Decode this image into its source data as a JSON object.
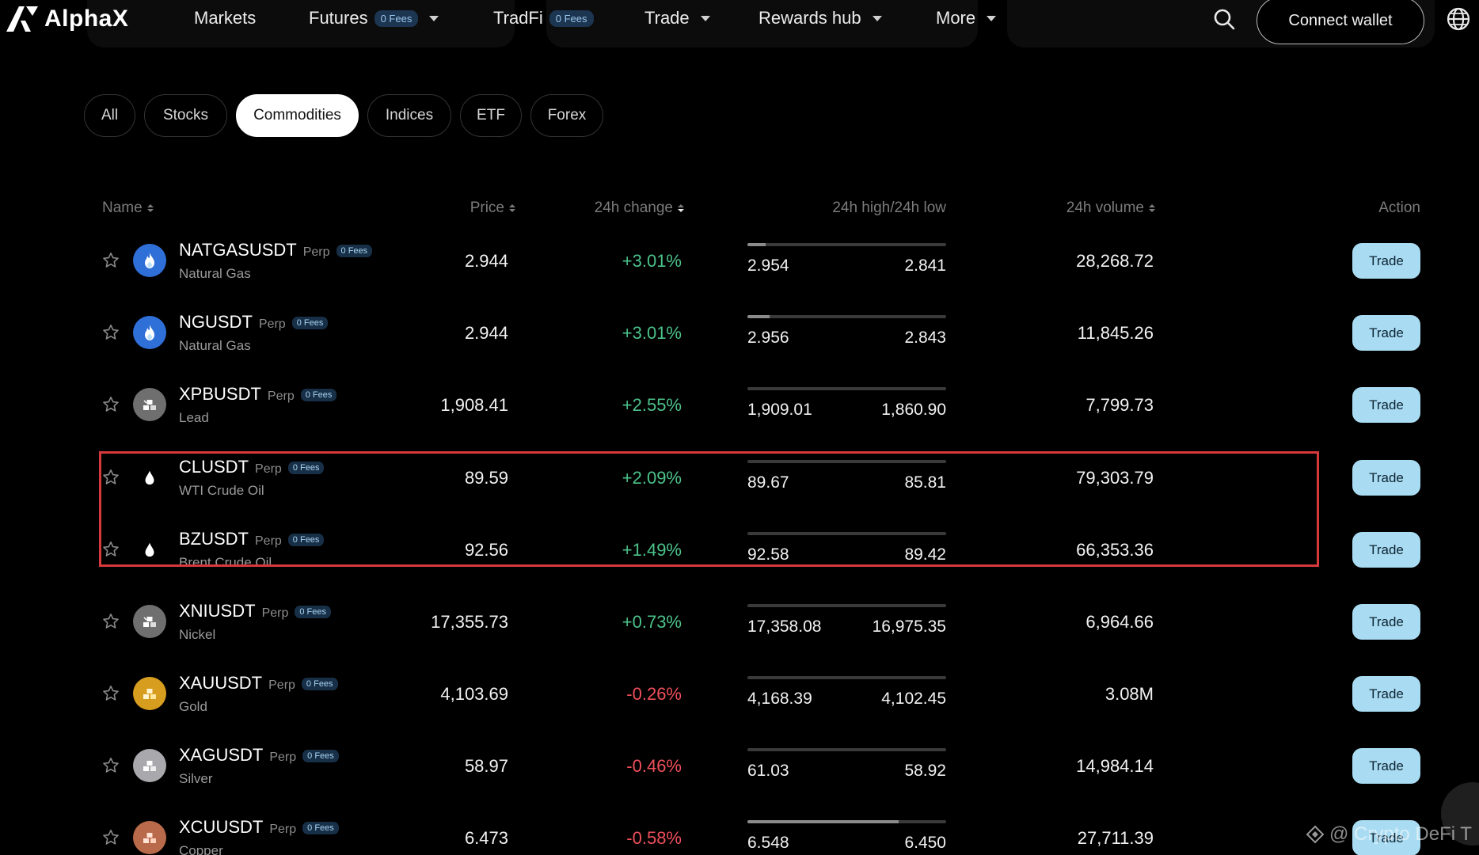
{
  "app": {
    "logo_text": "AlphaX"
  },
  "nav": {
    "items": [
      {
        "label": "Markets",
        "badge": "",
        "caret": false
      },
      {
        "label": "Futures",
        "badge": "0 Fees",
        "caret": true
      },
      {
        "label": "TradFi",
        "badge": "0 Fees",
        "caret": false
      },
      {
        "label": "Trade",
        "badge": "",
        "caret": true
      },
      {
        "label": "Rewards hub",
        "badge": "",
        "caret": true
      },
      {
        "label": "More",
        "badge": "",
        "caret": true
      }
    ],
    "connect_wallet": "Connect wallet"
  },
  "filters": {
    "tabs": [
      "All",
      "Stocks",
      "Commodities",
      "Indices",
      "ETF",
      "Forex"
    ],
    "active": "Commodities"
  },
  "table": {
    "headers": {
      "name": "Name",
      "price": "Price",
      "change": "24h change",
      "high_low": "24h high/24h low",
      "volume": "24h volume",
      "action": "Action"
    },
    "perp_label": "Perp",
    "fees_label": "0 Fees",
    "trade_label": "Trade",
    "rows": [
      {
        "symbol": "NATGASUSDT",
        "name": "Natural Gas",
        "icon": "flame-icon",
        "price": "2.944",
        "change": "+3.01%",
        "direction": "up",
        "high": "2.954",
        "low": "2.841",
        "range_fill": 0.09,
        "volume": "28,268.72"
      },
      {
        "symbol": "NGUSDT",
        "name": "Natural Gas",
        "icon": "flame-icon",
        "price": "2.944",
        "change": "+3.01%",
        "direction": "up",
        "high": "2.956",
        "low": "2.843",
        "range_fill": 0.11,
        "volume": "11,845.26"
      },
      {
        "symbol": "XPBUSDT",
        "name": "Lead",
        "icon": "metal-bars-icon",
        "price": "1,908.41",
        "change": "+2.55%",
        "direction": "up",
        "high": "1,909.01",
        "low": "1,860.90",
        "range_fill": 0.0,
        "volume": "7,799.73"
      },
      {
        "symbol": "CLUSDT",
        "name": "WTI Crude Oil",
        "icon": "oil-drop-icon",
        "price": "89.59",
        "change": "+2.09%",
        "direction": "up",
        "high": "89.67",
        "low": "85.81",
        "range_fill": 0.0,
        "volume": "79,303.79"
      },
      {
        "symbol": "BZUSDT",
        "name": "Brent Crude Oil",
        "icon": "oil-drop-icon",
        "price": "92.56",
        "change": "+1.49%",
        "direction": "up",
        "high": "92.58",
        "low": "89.42",
        "range_fill": 0.0,
        "volume": "66,353.36"
      },
      {
        "symbol": "XNIUSDT",
        "name": "Nickel",
        "icon": "metal-bars-icon",
        "price": "17,355.73",
        "change": "+0.73%",
        "direction": "up",
        "high": "17,358.08",
        "low": "16,975.35",
        "range_fill": 0.0,
        "volume": "6,964.66"
      },
      {
        "symbol": "XAUUSDT",
        "name": "Gold",
        "icon": "gold-bars-icon",
        "price": "4,103.69",
        "change": "-0.26%",
        "direction": "down",
        "high": "4,168.39",
        "low": "4,102.45",
        "range_fill": 0.0,
        "volume": "3.08M"
      },
      {
        "symbol": "XAGUSDT",
        "name": "Silver",
        "icon": "silver-bars-icon",
        "price": "58.97",
        "change": "-0.46%",
        "direction": "down",
        "high": "61.03",
        "low": "58.92",
        "range_fill": 0.0,
        "volume": "14,984.14"
      },
      {
        "symbol": "XCUUSDT",
        "name": "Copper",
        "icon": "copper-bars-icon",
        "price": "6.473",
        "change": "-0.58%",
        "direction": "down",
        "high": "6.548",
        "low": "6.450",
        "range_fill": 0.76,
        "volume": "27,711.39"
      }
    ]
  },
  "watermark": "@ Crypto DeFi T"
}
